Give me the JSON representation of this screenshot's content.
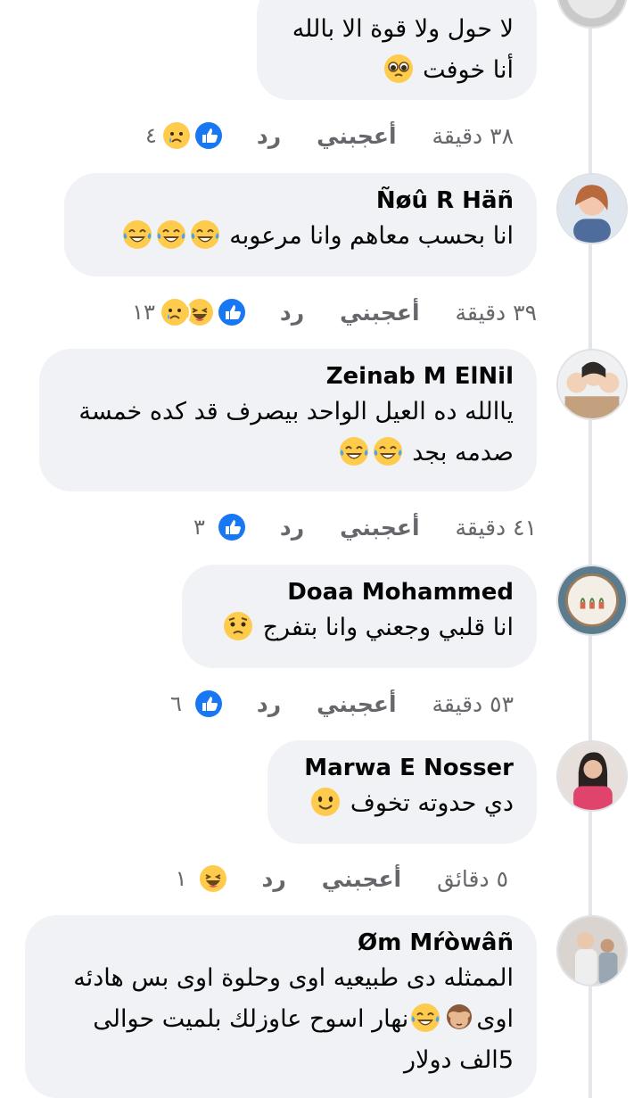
{
  "colors": {
    "bubble": "#f0f2f5",
    "meta_text": "#65676b",
    "like_blue": "#1877f2",
    "emoji_yellow": "#ffcb4c",
    "thread_line": "#e4e6eb"
  },
  "labels": {
    "like": "أعجبني",
    "reply": "رد"
  },
  "comments": [
    {
      "author": "",
      "lines": [
        "لا حول ولا قوة الا بالله",
        "أنا خوفت"
      ],
      "emojis": [
        "pleading-face"
      ],
      "time": "٣٨ دقيقة",
      "reactions": [
        "like",
        "sad"
      ],
      "count": "٤"
    },
    {
      "author": "Ñøû R Häñ",
      "lines": [
        "انا بحسب معاهم وانا مرعوبه"
      ],
      "emojis": [
        "tears-of-joy",
        "tears-of-joy",
        "tears-of-joy"
      ],
      "time": "٣٩ دقيقة",
      "reactions": [
        "like",
        "haha",
        "sad"
      ],
      "count": "١٣"
    },
    {
      "author": "Zeinab M ElNil",
      "lines": [
        "ياالله ده العيل الواحد بيصرف قد كده خمسة",
        "صدمه بجد"
      ],
      "emojis": [
        "tears-of-joy",
        "tears-of-joy"
      ],
      "time": "٤١ دقيقة",
      "reactions": [
        "like"
      ],
      "count": "٣"
    },
    {
      "author": "Doaa Mohammed",
      "lines": [
        "انا قلبي وجعني وانا بتفرج"
      ],
      "emojis": [
        "worried-face"
      ],
      "time": "٥٣ دقيقة",
      "reactions": [
        "like"
      ],
      "count": "٦"
    },
    {
      "author": "Marwa E Nosser",
      "lines": [
        "دي حدوته تخوف"
      ],
      "emojis": [
        "slight-smile"
      ],
      "time": "٥ دقائق",
      "reactions": [
        "haha"
      ],
      "count": "١"
    },
    {
      "author": "Øm Mŕòwâñ",
      "lines": [
        "الممثله دى طبيعيه اوى وحلوة اوى بس هادئه",
        "اوى",
        "نهار اسوح عاوزلك بلميت حوالى",
        "5الف دولار"
      ],
      "emojis": [
        "see-no-evil-monkey",
        "tears-of-joy"
      ],
      "time": "",
      "reactions": [],
      "count": ""
    }
  ]
}
